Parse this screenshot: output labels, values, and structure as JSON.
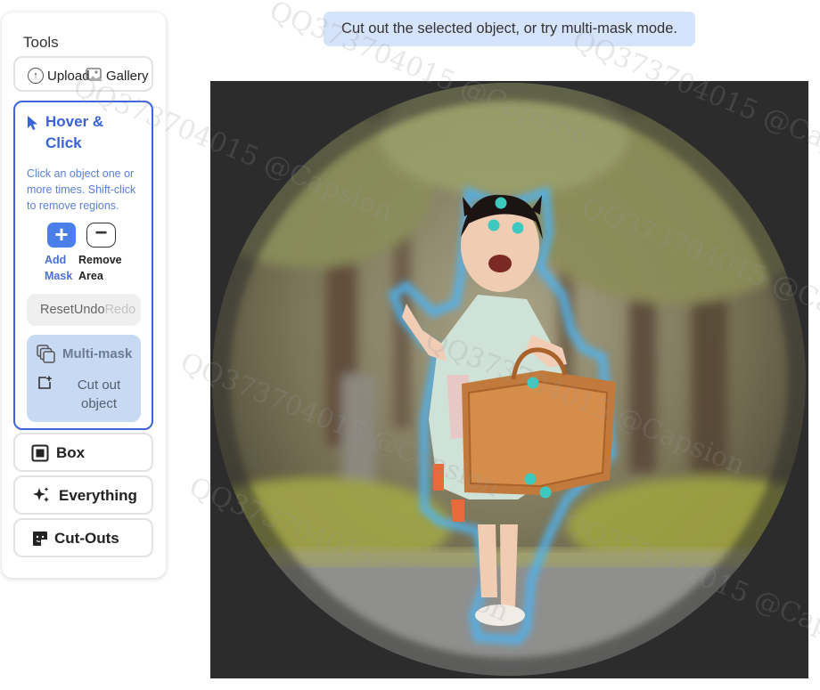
{
  "sidebar": {
    "title": "Tools",
    "upload_label": "Upload",
    "gallery_label": "Gallery",
    "hover_click": {
      "title": "Hover & Click",
      "description": "Click an object one or more times. Shift-click to remove regions.",
      "add_mask_label": "Add Mask",
      "remove_area_label": "Remove Area",
      "reset_label": "Reset",
      "undo_label": "Undo",
      "redo_label": "Redo",
      "multi_mask_label": "Multi-mask",
      "cut_out_label": "Cut out object"
    },
    "box_label": "Box",
    "everything_label": "Everything",
    "cutouts_label": "Cut-Outs"
  },
  "hint": {
    "text": "Cut out the selected object, or try multi-mask mode."
  },
  "watermarks": [
    "QQ373704015 @Capsion"
  ],
  "colors": {
    "accent": "#3d63dd",
    "hint_bg": "#d5e3fb",
    "click_point": "#3ec9c0",
    "mask_glow": "#4fb3f0"
  }
}
